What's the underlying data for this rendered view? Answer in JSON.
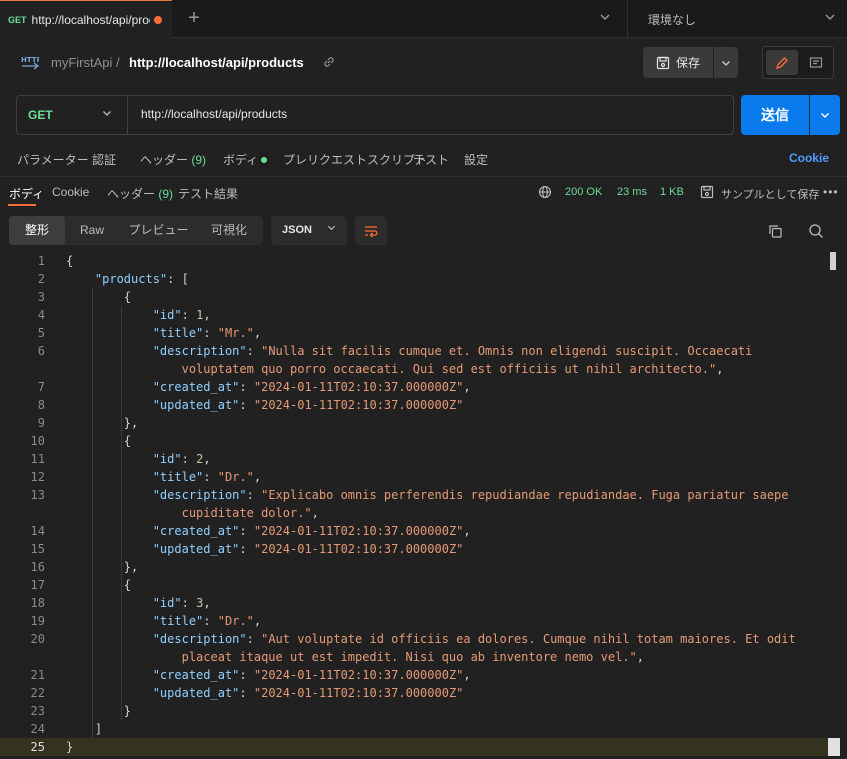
{
  "tabbar": {
    "tab_method": "GET",
    "tab_title": "http://localhost/api/products",
    "environment": "環境なし"
  },
  "header": {
    "collection": "myFirstApi",
    "separator": "/",
    "request_name": "http://localhost/api/products",
    "save_label": "保存"
  },
  "request": {
    "method": "GET",
    "url": "http://localhost/api/products",
    "send_label": "送信"
  },
  "request_tabs": {
    "params": "パラメーター",
    "auth": "認証",
    "headers": "ヘッダー",
    "headers_count": "(9)",
    "body": "ボディ",
    "prerequest": "プレリクエストスクリプト",
    "tests": "テスト",
    "settings": "設定",
    "cookies": "Cookie"
  },
  "response": {
    "tabs": {
      "body": "ボディ",
      "cookies": "Cookie",
      "headers": "ヘッダー",
      "headers_count": "(9)",
      "test_results": "テスト結果"
    },
    "status": "200 OK",
    "time": "23 ms",
    "size": "1 KB",
    "save_sample": "サンプルとして保存"
  },
  "format": {
    "pretty": "整形",
    "raw": "Raw",
    "preview": "プレビュー",
    "visualize": "可視化",
    "language": "JSON"
  },
  "code_lines": [
    "{",
    "    \"products\": [",
    "        {",
    "            \"id\": 1,",
    "            \"title\": \"Mr.\",",
    "            \"description\": \"Nulla sit facilis cumque et. Omnis non eligendi suscipit. Occaecati",
    "                voluptatem quo porro occaecati. Qui sed est officiis ut nihil architecto.\",",
    "            \"created_at\": \"2024-01-11T02:10:37.000000Z\",",
    "            \"updated_at\": \"2024-01-11T02:10:37.000000Z\"",
    "        },",
    "        {",
    "            \"id\": 2,",
    "            \"title\": \"Dr.\",",
    "            \"description\": \"Explicabo omnis perferendis repudiandae repudiandae. Fuga pariatur saepe",
    "                cupiditate dolor.\",",
    "            \"created_at\": \"2024-01-11T02:10:37.000000Z\",",
    "            \"updated_at\": \"2024-01-11T02:10:37.000000Z\"",
    "        },",
    "        {",
    "            \"id\": 3,",
    "            \"title\": \"Dr.\",",
    "            \"description\": \"Aut voluptate id officiis ea dolores. Cumque nihil totam maiores. Et odit",
    "                placeat itaque ut est impedit. Nisi quo ab inventore nemo vel.\",",
    "            \"created_at\": \"2024-01-11T02:10:37.000000Z\",",
    "            \"updated_at\": \"2024-01-11T02:10:37.000000Z\"",
    "        }",
    "    ]",
    "}"
  ],
  "line_numbers": [
    "1",
    "2",
    "3",
    "4",
    "5",
    "6",
    "",
    "7",
    "8",
    "9",
    "10",
    "11",
    "12",
    "13",
    "",
    "14",
    "15",
    "16",
    "17",
    "18",
    "19",
    "20",
    "",
    "21",
    "22",
    "23",
    "24",
    "25"
  ]
}
